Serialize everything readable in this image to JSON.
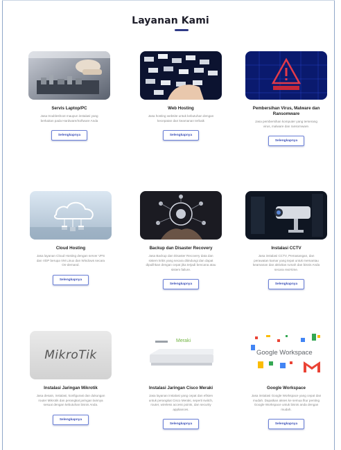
{
  "section": {
    "title": "Layanan Kami"
  },
  "services": [
    {
      "name": "Servis Laptop/PC",
      "desc": "Jasa troubleshoot maupun instalasi yang berkaitan pada Hardware/Software Anda",
      "button": "Selengkapnya",
      "icon": "laptop-repair-image"
    },
    {
      "name": "Web Hosting",
      "desc": "Jasa hosting website untuk kebutuhan dengan kecepatan dan keamanan terbaik",
      "button": "Selengkapnya",
      "icon": "web-hosting-image"
    },
    {
      "name": "Pembersihan Virus, Malware dan Ransomware",
      "desc": "Jasa pembersihan komputer yang terserang virus, malware dan ransomware.",
      "button": "Selengkapnya",
      "icon": "virus-warning-image"
    },
    {
      "name": "Cloud Hosting",
      "desc": "Jasa layanan Cloud Hosting dengan server VPS dan VDP berupa VM Linux dan Windows secara On-demand.",
      "button": "Selengkapnya",
      "icon": "cloud-hosting-image"
    },
    {
      "name": "Backup dan Disaster Recovery",
      "desc": "Jasa Backup dan Disaster Recovery data dan sistem kritis yang secara ditindungi dan dapat dipulihkan dengan cepat jika terjadi bencana atau sistem failure.",
      "button": "Selengkapnya",
      "icon": "backup-recovery-image"
    },
    {
      "name": "Instalasi CCTV",
      "desc": "Jasa instalasi CCTV, Pemasangan, dan perawatan kamar yang tepat untuk memantau keamanan dan aktivitas rumah dan bisnis Anda secara real-time.",
      "button": "Selengkapnya",
      "icon": "cctv-camera-image"
    },
    {
      "name": "Instalasi Jaringan Mikrotik",
      "desc": "Jasa desain, instalasi, konfigurasi dan dukungan router Mikrotik dan perangkat jaringan lainnya sesuai dengan kebutuhan bisnis Anda.",
      "button": "Selengkapnya",
      "icon": "mikrotik-logo-image",
      "logo_text": "MikroTik"
    },
    {
      "name": "Instalasi Jaringan Cisco Meraki",
      "desc": "Jasa layanan instalasi yang cepat dan efisien untuk perangkat Cisco Meraki, seperti switch, router, wireless access points, dan security appliances.",
      "button": "Selengkapnya",
      "icon": "cisco-meraki-image",
      "logo_text": "Meraki"
    },
    {
      "name": "Google Workspace",
      "desc": "Jasa instalasi Google Workspace yang cepat dan mudah. Dapatkan akses ke semua fitur penting Google Workspace untuk bisnis anda dengan mudah.",
      "button": "Selengkapnya",
      "icon": "google-workspace-image",
      "logo_text": "Google Workspace"
    }
  ]
}
